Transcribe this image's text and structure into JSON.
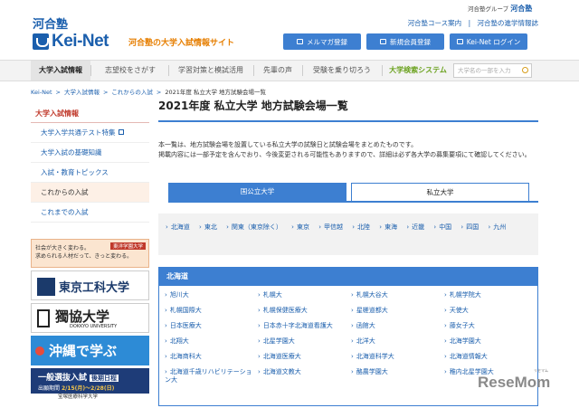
{
  "header": {
    "brand_small": "河合塾",
    "logo_text": "Kei-Net",
    "tagline": "河合塾の大学入試情報サイト",
    "group_prefix": "河合塾グループ",
    "group_name": "河合塾",
    "top_links": [
      "河合塾コース案内",
      "河合塾の進学情報誌"
    ],
    "top_link_sep": "|",
    "buttons": [
      {
        "label": "メルマガ登録",
        "icon": "mail-icon"
      },
      {
        "label": "新規会員登録",
        "icon": "register-icon"
      },
      {
        "label": "Kei-Net ログイン",
        "icon": "login-icon"
      }
    ]
  },
  "nav": {
    "items": [
      "大学入試情報",
      "志望校をさがす",
      "学習対策と模試活用",
      "先輩の声",
      "受験を乗り切ろう",
      "大学検索システム"
    ],
    "search_placeholder": "大学名の一部を入力"
  },
  "breadcrumb": [
    "Kei-Net",
    "大学入試情報",
    "これからの入試",
    "2021年度 私立大学 地方試験会場一覧"
  ],
  "breadcrumb_sep": ">",
  "sidebar": {
    "heading": "大学入試情報",
    "items": [
      "大学入学共通テスト特集",
      "大学入試の基礎知識",
      "入試・教育トピックス",
      "これからの入試",
      "これまでの入試"
    ]
  },
  "banners": {
    "b1_text_l1": "社会が大きく変わる。",
    "b1_text_l2": "求められる人材だって、きっと変わる。",
    "b1_tag": "東洋学園大学",
    "b2_text": "東京工科大学",
    "b3_text": "獨協大学",
    "b3_sub": "DOKKYO UNIVERSITY",
    "b4_text": "沖縄で学ぶ",
    "b5_title": "一般選抜入試",
    "b5_tag": "後期日程",
    "b5_date_label": "出願期間",
    "b5_date": "2/15(月)～2/28(日)",
    "b5_univ": "宝塚医療科学大学"
  },
  "main": {
    "title": "2021年度 私立大学 地方試験会場一覧",
    "intro_l1": "本一覧は、地方試験会場を設置している私立大学の試験日と試験会場をまとめたものです。",
    "intro_l2": "掲載内容には一部予定を含んでおり、今後変更される可能性もありますので、詳細は必ず各大学の募集要項にて確認してください。",
    "tabs": [
      "国公立大学",
      "私立大学"
    ],
    "regions": [
      "北海道",
      "東北",
      "関東（東京除く）",
      "東京",
      "甲信越",
      "北陸",
      "東海",
      "近畿",
      "中国",
      "四国",
      "九州"
    ],
    "section_title": "北海道",
    "universities": [
      "旭川大",
      "札幌大",
      "札幌大谷大",
      "札幌学院大",
      "札幌国際大",
      "札幌保健医療大",
      "星槎道都大",
      "天使大",
      "日本医療大",
      "日本赤十字北海道看護大",
      "函館大",
      "藤女子大",
      "北翔大",
      "北星学園大",
      "北洋大",
      "北海学園大",
      "北海商科大",
      "北海道医療大",
      "北海道科学大",
      "北海道情報大",
      "北海道千歳リハビリテーション大",
      "北海道文教大",
      "酪農学園大",
      "稚内北星学園大"
    ]
  },
  "watermark": {
    "text": "ReseMom",
    "small": "リセマム"
  }
}
